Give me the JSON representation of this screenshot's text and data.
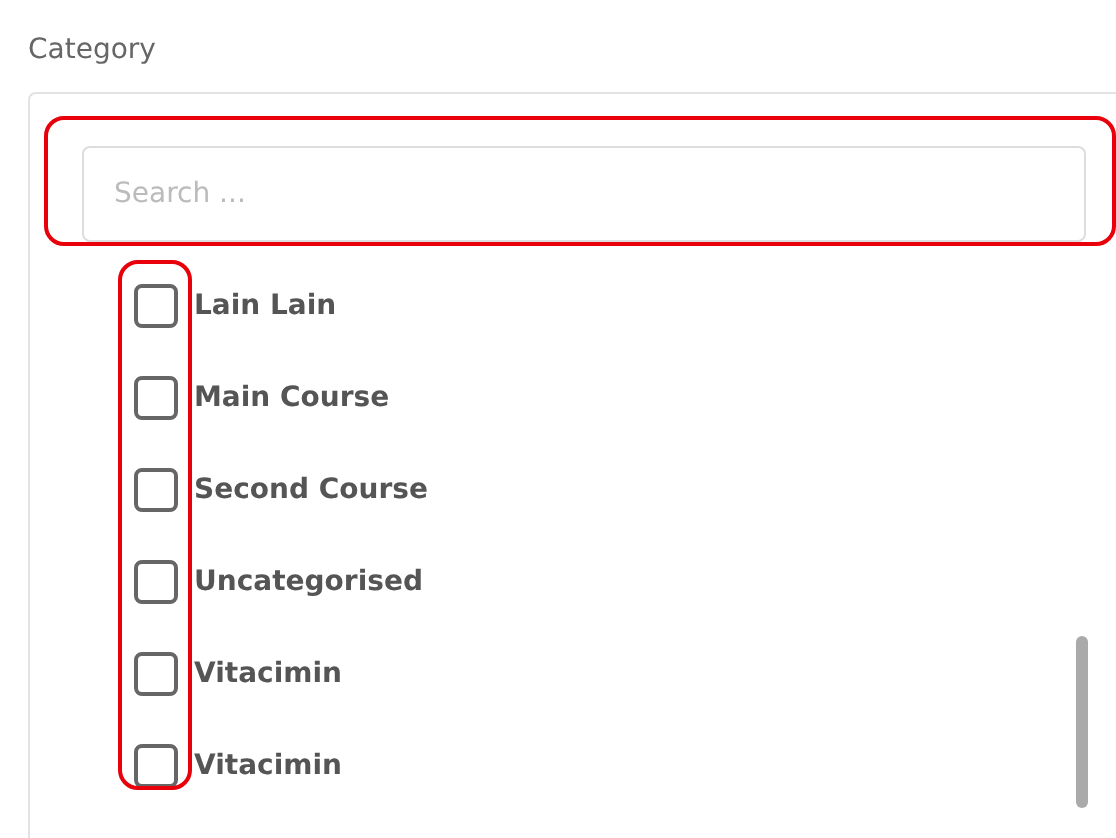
{
  "field_label": "Category",
  "search": {
    "placeholder": "Search ..."
  },
  "categories": [
    {
      "label": "Lain Lain",
      "checked": false
    },
    {
      "label": "Main Course",
      "checked": false
    },
    {
      "label": "Second Course",
      "checked": false
    },
    {
      "label": "Uncategorised",
      "checked": false
    },
    {
      "label": "Vitacimin",
      "checked": false
    },
    {
      "label": "Vitacimin",
      "checked": false
    }
  ]
}
